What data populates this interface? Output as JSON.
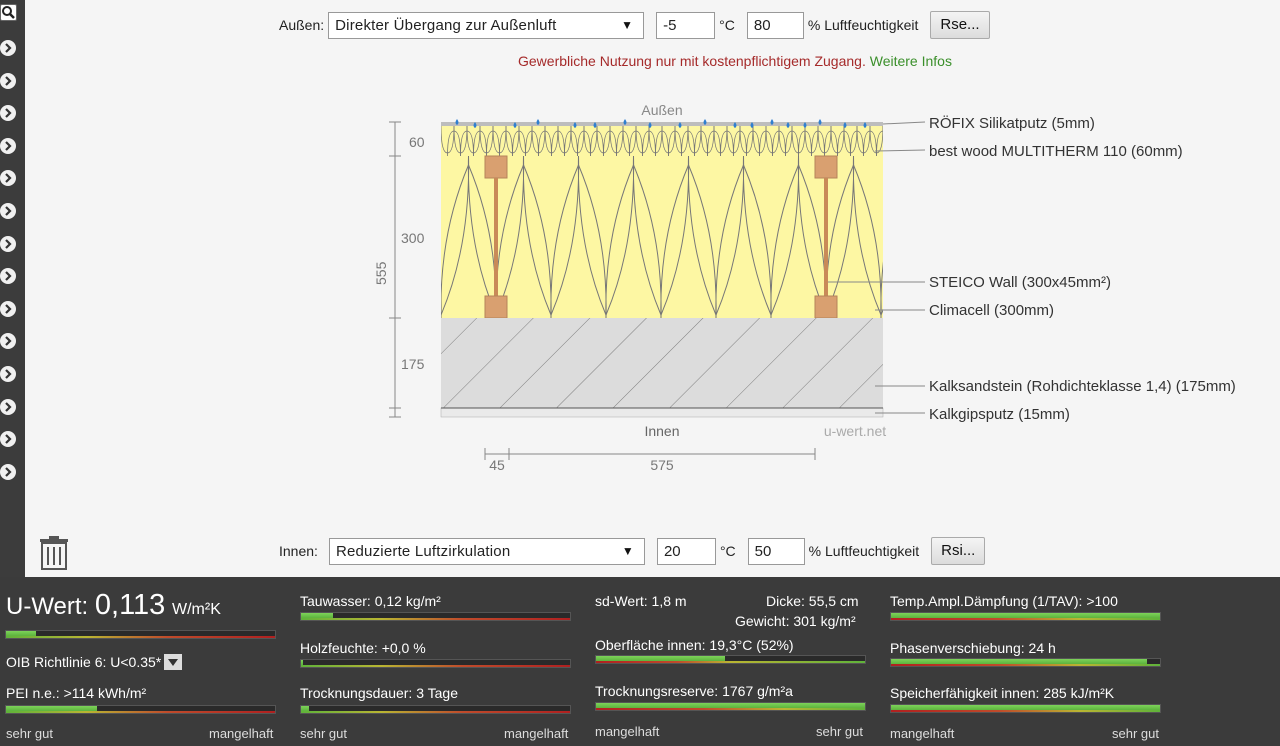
{
  "outside": {
    "label": "Außen:",
    "select_value": "Direkter Übergang zur Außenluft",
    "temperature": "-5",
    "temp_unit": "°C",
    "humidity": "80",
    "humidity_unit": "% Luftfeuchtigkeit",
    "button": "Rse..."
  },
  "notice": {
    "text": "Gewerbliche Nutzung nur mit kostenpflichtigem Zugang.",
    "link": "Weitere Infos"
  },
  "drawing": {
    "top_label": "Außen",
    "bottom_label": "Innen",
    "watermark": "u-wert.net",
    "total_thickness": "555",
    "dims": [
      "60",
      "300",
      "175"
    ],
    "bottom_dims": [
      "45",
      "575"
    ],
    "layers": [
      "RÖFIX Silikatputz (5mm)",
      "best wood MULTITHERM 110 (60mm)",
      "STEICO  Wall (300x45mm²)",
      "Climacell (300mm)",
      "Kalksandstein (Rohdichteklasse 1,4) (175mm)",
      "Kalkgipsputz (15mm)"
    ]
  },
  "inside": {
    "label": "Innen:",
    "select_value": "Reduzierte Luftzirkulation",
    "temperature": "20",
    "temp_unit": "°C",
    "humidity": "50",
    "humidity_unit": "% Luftfeuchtigkeit",
    "button": "Rsi..."
  },
  "results": {
    "uwert_label": "U-Wert:",
    "uwert_value": "0,113",
    "uwert_unit": "W/m²K",
    "uwert_bar": 0.11,
    "oib": "OIB Richtlinie 6: U<0.35*",
    "pei": "PEI n.e.: >114 kWh/m²",
    "pei_bar": 0.34,
    "tauwasser": "Tauwasser: 0,12 kg/m²",
    "tauwasser_bar": 0.12,
    "holzfeuchte": "Holzfeuchte: +0,0 %",
    "holzfeuchte_bar": 0.0,
    "trocknungsdauer": "Trocknungsdauer: 3 Tage",
    "trocknungsdauer_bar": 0.03,
    "sd": "sd-Wert: 1,8 m",
    "dicke": "Dicke: 55,5 cm",
    "gewicht": "Gewicht: 301 kg/m²",
    "oberflaeche": "Oberfläche innen: 19,3°C (52%)",
    "oberflaeche_bar": 0.48,
    "trocknungsreserve": "Trocknungsreserve: 1767 g/m²a",
    "trocknungsreserve_bar": 1.0,
    "temp_ampl": "Temp.Ampl.Dämpfung (1/TAV): >100",
    "temp_ampl_bar": 1.0,
    "phase": "Phasenverschiebung: 24 h",
    "phase_bar": 0.95,
    "speicher": "Speicherfähigkeit innen: 285 kJ/m²K",
    "speicher_bar": 1.0,
    "scale_good": "sehr gut",
    "scale_bad": "mangelhaft"
  }
}
